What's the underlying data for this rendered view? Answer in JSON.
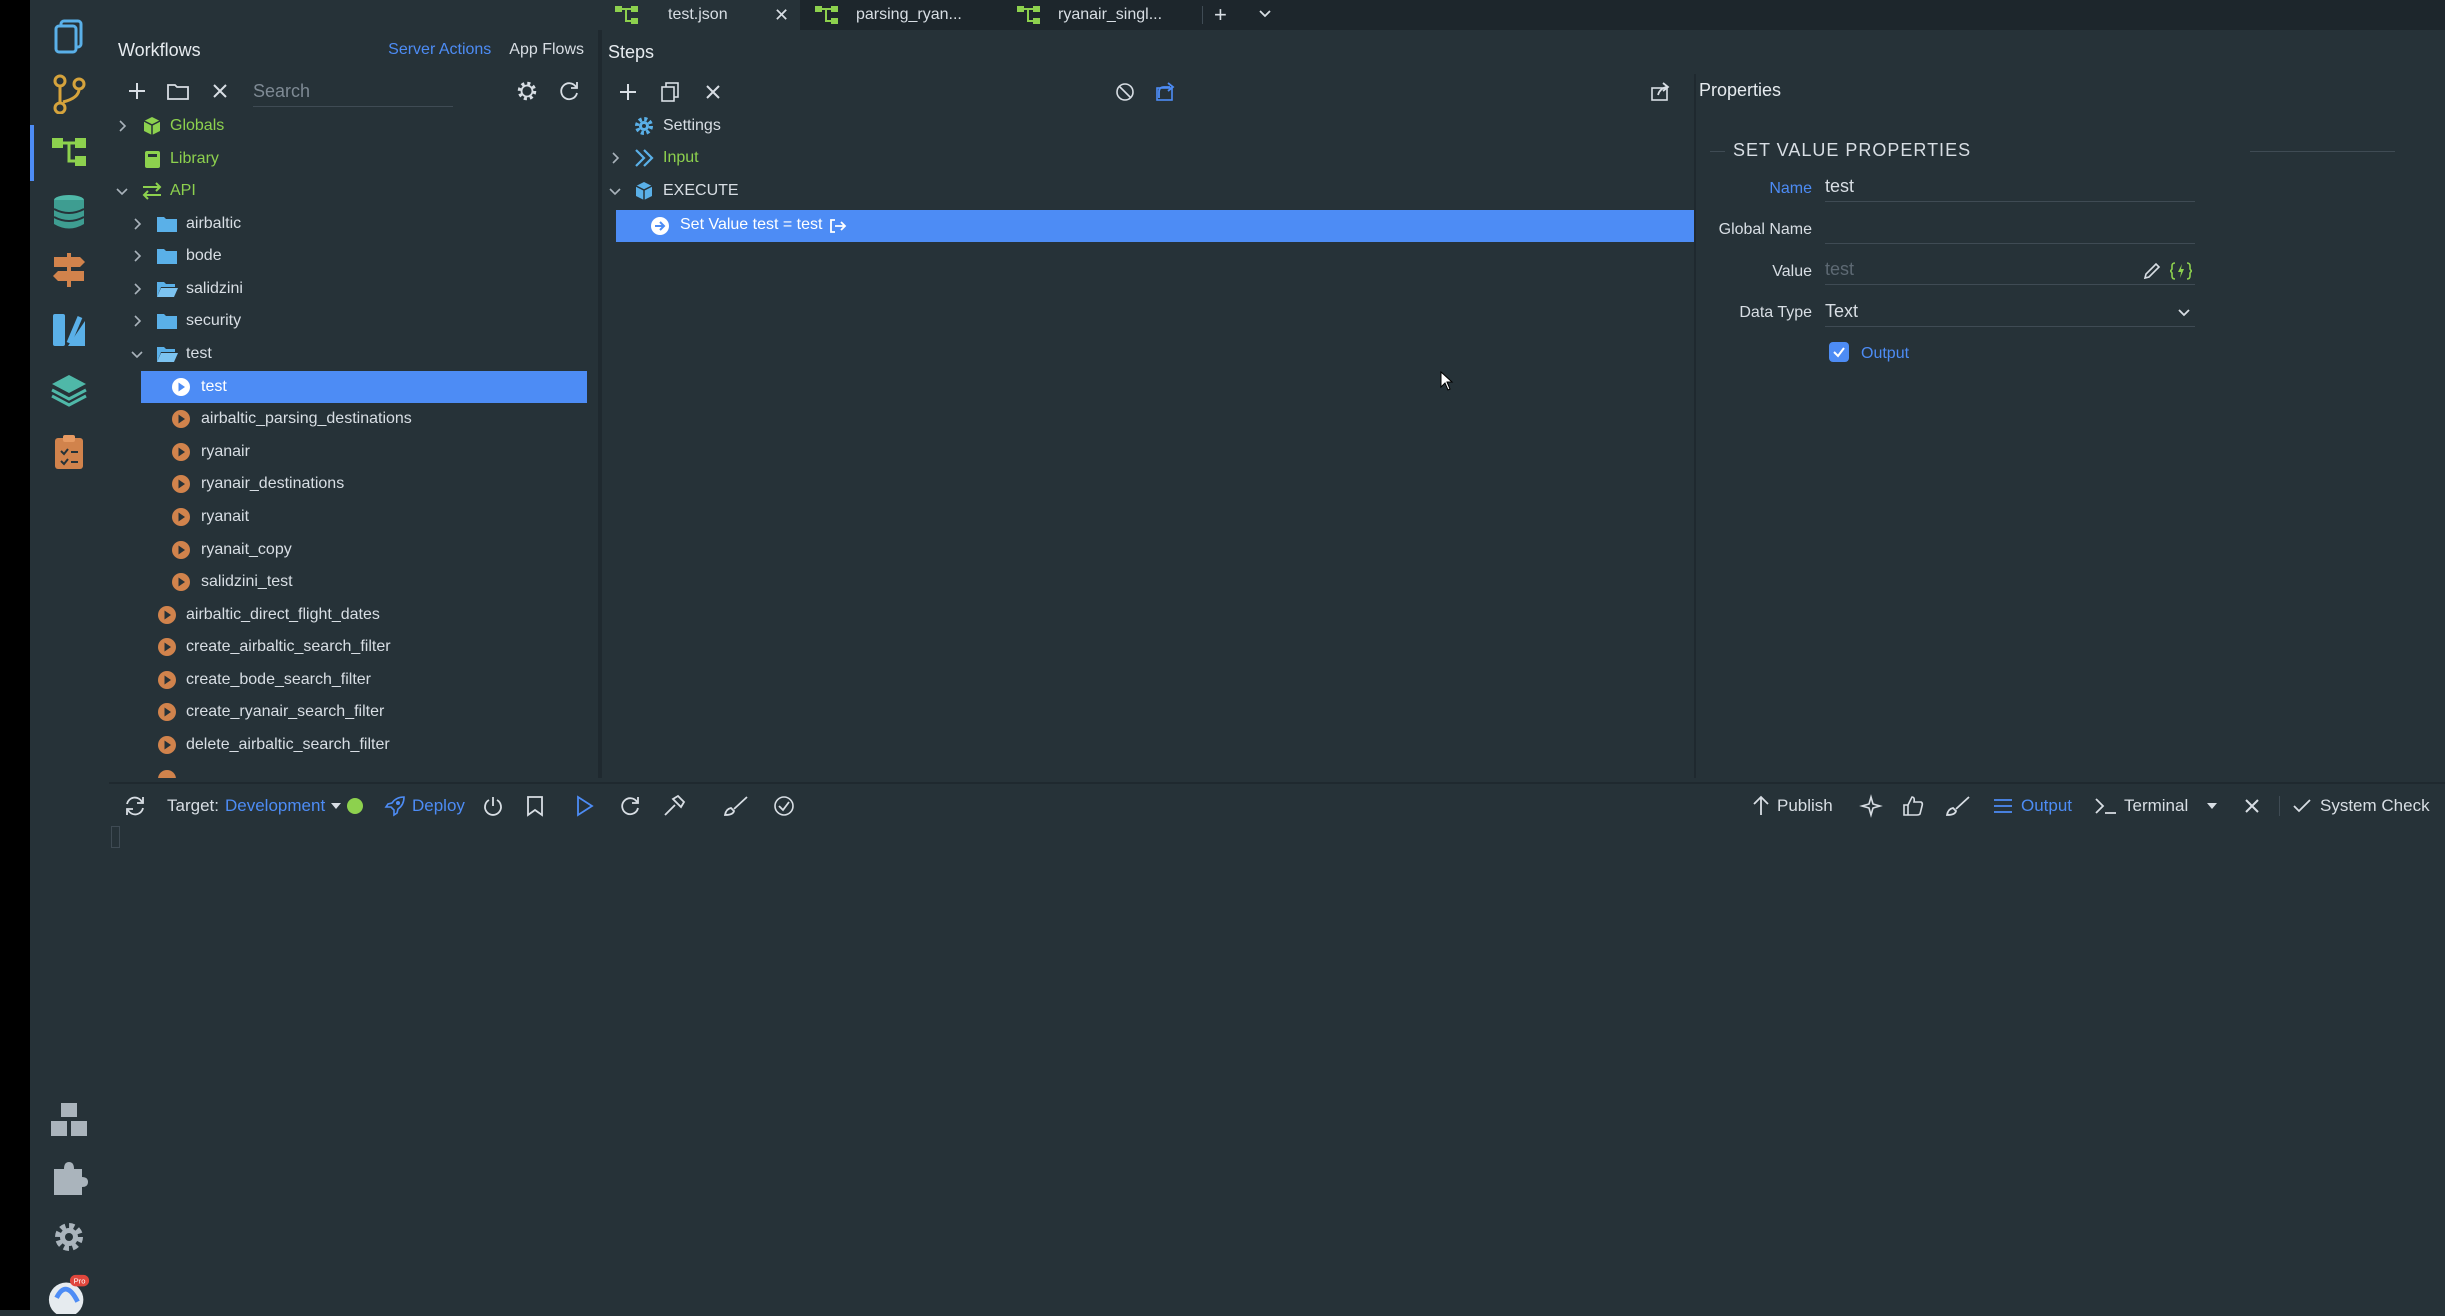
{
  "tabs": [
    {
      "label": "test.json",
      "active": true
    },
    {
      "label": "parsing_ryan...",
      "active": false
    },
    {
      "label": "ryanair_singl...",
      "active": false
    }
  ],
  "workflows": {
    "title": "Workflows",
    "links": [
      "Server Actions",
      "App Flows"
    ],
    "search_placeholder": "Search",
    "tree": [
      {
        "label": "Globals",
        "kind": "globals",
        "depth": 0,
        "expanded": false,
        "color": "#8dd14e"
      },
      {
        "label": "Library",
        "kind": "library",
        "depth": 0,
        "expanded": null,
        "color": "#8dd14e"
      },
      {
        "label": "API",
        "kind": "api",
        "depth": 0,
        "expanded": true,
        "color": "#8dd14e"
      },
      {
        "label": "airbaltic",
        "kind": "folder",
        "depth": 1,
        "expanded": false
      },
      {
        "label": "bode",
        "kind": "folder",
        "depth": 1,
        "expanded": false
      },
      {
        "label": "salidzini",
        "kind": "folder-open",
        "depth": 1,
        "expanded": false
      },
      {
        "label": "security",
        "kind": "folder",
        "depth": 1,
        "expanded": false
      },
      {
        "label": "test",
        "kind": "folder-open",
        "depth": 1,
        "expanded": true
      },
      {
        "label": "test",
        "kind": "action",
        "depth": 2,
        "selected": true
      },
      {
        "label": "airbaltic_parsing_destinations",
        "kind": "action",
        "depth": 2
      },
      {
        "label": "ryanair",
        "kind": "action",
        "depth": 2
      },
      {
        "label": "ryanair_destinations",
        "kind": "action",
        "depth": 2
      },
      {
        "label": "ryanait",
        "kind": "action",
        "depth": 2
      },
      {
        "label": "ryanait_copy",
        "kind": "action",
        "depth": 2
      },
      {
        "label": "salidzini_test",
        "kind": "action",
        "depth": 2
      },
      {
        "label": "airbaltic_direct_flight_dates",
        "kind": "action",
        "depth": 1
      },
      {
        "label": "create_airbaltic_search_filter",
        "kind": "action",
        "depth": 1
      },
      {
        "label": "create_bode_search_filter",
        "kind": "action",
        "depth": 1
      },
      {
        "label": "create_ryanair_search_filter",
        "kind": "action",
        "depth": 1
      },
      {
        "label": "delete_airbaltic_search_filter",
        "kind": "action",
        "depth": 1
      }
    ]
  },
  "steps": {
    "title": "Steps",
    "items": [
      {
        "label": "Settings",
        "icon": "gear-icon",
        "chevron": false
      },
      {
        "label": "Input",
        "icon": "input-icon",
        "chevron": true,
        "color": "#8dd14e"
      },
      {
        "label": "EXECUTE",
        "icon": "cube-icon",
        "chevron": true,
        "expanded": true
      },
      {
        "label": "Set Value test = test",
        "icon": "set-value-icon",
        "selected": true
      }
    ]
  },
  "properties": {
    "title": "Properties",
    "section": "SET VALUE PROPERTIES",
    "name_label": "Name",
    "name_value": "test",
    "global_name_label": "Global Name",
    "global_name_value": "",
    "value_label": "Value",
    "value_placeholder": "test",
    "data_type_label": "Data Type",
    "data_type_value": "Text",
    "output_label": "Output",
    "output_checked": true
  },
  "bottom": {
    "target_label": "Target:",
    "target_value": "Development",
    "deploy_label": "Deploy",
    "publish_label": "Publish",
    "output_label": "Output",
    "terminal_label": "Terminal",
    "system_check_label": "System Check"
  },
  "colors": {
    "accent": "#4d8cf5",
    "green": "#8dd14e",
    "action_orange": "#d1834c",
    "folder_blue": "#5ab0e8"
  }
}
